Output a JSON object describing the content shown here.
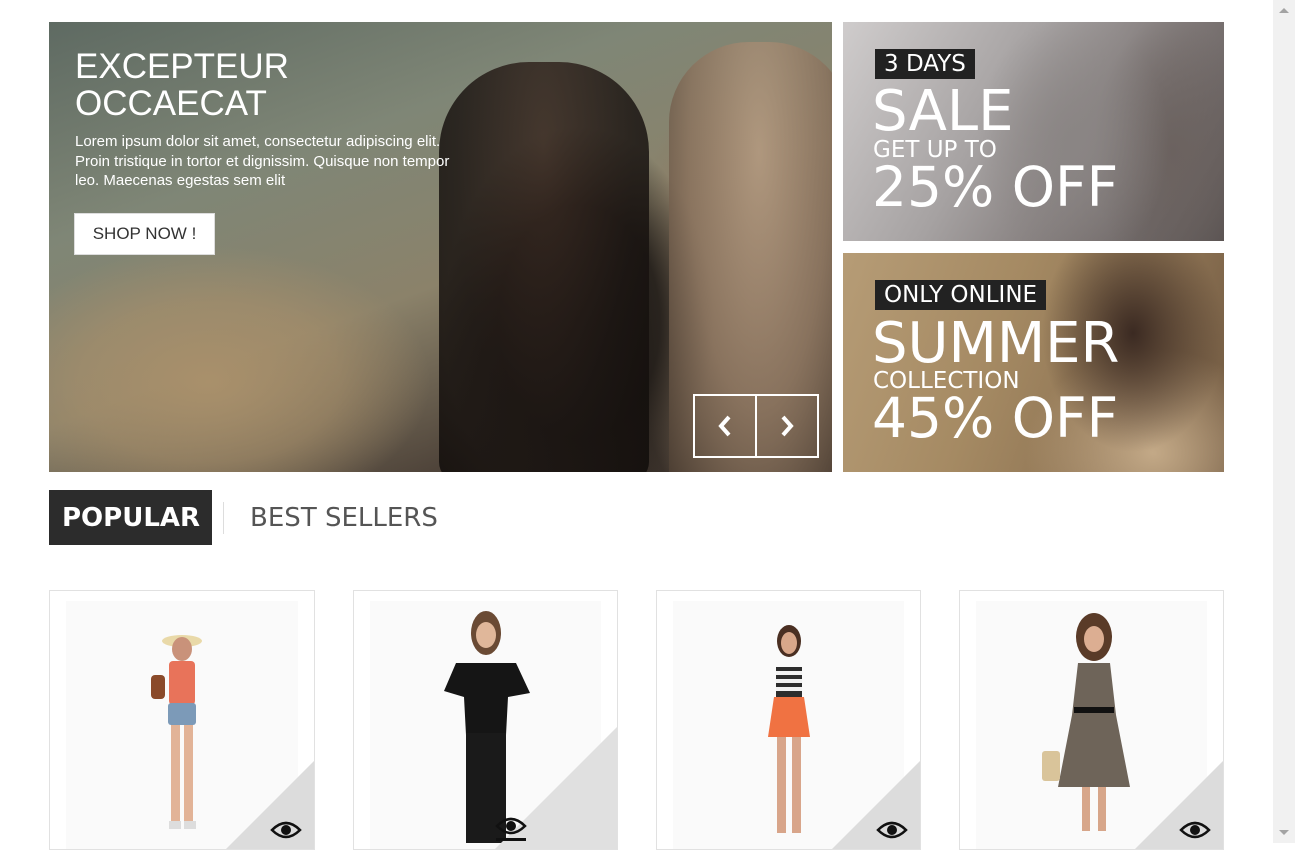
{
  "hero": {
    "title": "EXCEPTEUR OCCAECAT",
    "description": "Lorem ipsum dolor sit amet, consectetur adipiscing elit. Proin tristique in tortor et dignissim. Quisque non tempor leo. Maecenas egestas sem elit",
    "button_label": "SHOP NOW !",
    "prev_icon": "chevron-left-icon",
    "next_icon": "chevron-right-icon"
  },
  "banners": [
    {
      "tag": "3 DAYS",
      "headline": "SALE",
      "subline": "GET UP TO",
      "offer": "25% OFF"
    },
    {
      "tag": "ONLY ONLINE",
      "headline": "SUMMER",
      "subline": "COLLECTION",
      "offer": "45% OFF"
    }
  ],
  "tabs": {
    "active": "POPULAR",
    "inactive": "BEST SELLERS"
  },
  "products": [
    {
      "quick_view_icon": "eye-icon",
      "top_color": "#e8735a",
      "bottom_color": "#7c9ab8"
    },
    {
      "quick_view_icon": "eye-icon",
      "top_color": "#1a1a1a",
      "bottom_color": "#1a1a1a"
    },
    {
      "quick_view_icon": "eye-icon",
      "top_color": "#2d2d2d",
      "bottom_color": "#f07242"
    },
    {
      "quick_view_icon": "eye-icon",
      "top_color": "#6e6459",
      "bottom_color": "#8a7f72"
    }
  ]
}
